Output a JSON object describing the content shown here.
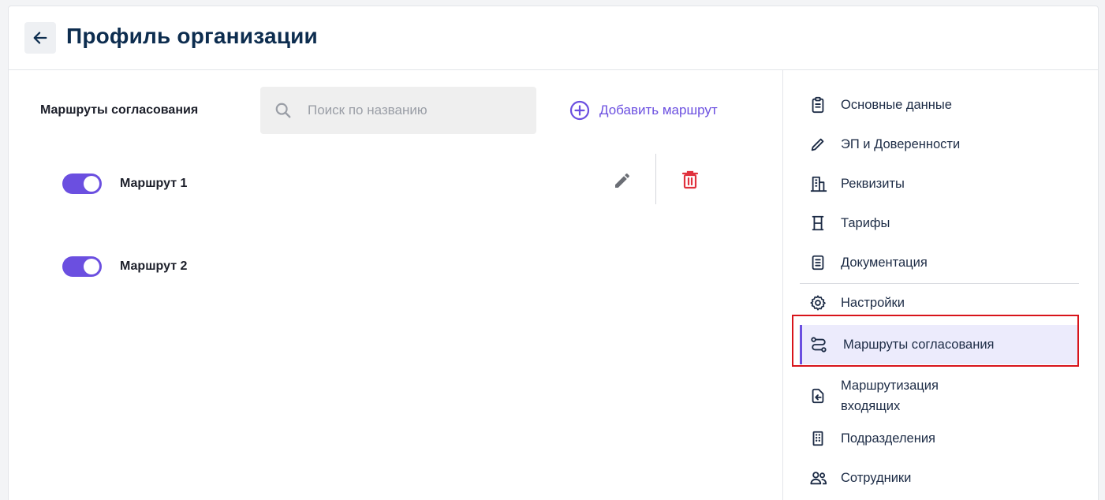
{
  "header": {
    "title": "Профиль организации",
    "back_icon": "arrow-left-icon"
  },
  "main": {
    "section_title": "Маршруты согласования",
    "search": {
      "placeholder": "Поиск по названию",
      "value": ""
    },
    "add_route_label": "Добавить маршрут",
    "routes": [
      {
        "name": "Маршрут 1",
        "enabled": true
      },
      {
        "name": "Маршрут 2",
        "enabled": true
      }
    ]
  },
  "sidebar": {
    "items": [
      {
        "label": "Основные данные",
        "icon": "clipboard-icon"
      },
      {
        "label": "ЭП и Доверенности",
        "icon": "pencil-icon"
      },
      {
        "label": "Реквизиты",
        "icon": "building-icon"
      },
      {
        "label": "Тарифы",
        "icon": "tariff-icon"
      },
      {
        "label": "Документация",
        "icon": "document-icon"
      },
      {
        "label": "Настройки",
        "icon": "gear-icon"
      },
      {
        "label": "Маршруты согласования",
        "icon": "route-icon",
        "active": true
      },
      {
        "label": "Маршрутизация входящих",
        "icon": "incoming-icon"
      },
      {
        "label": "Подразделения",
        "icon": "departments-icon"
      },
      {
        "label": "Сотрудники",
        "icon": "users-icon"
      }
    ]
  },
  "colors": {
    "accent": "#6b4fe0",
    "title": "#0d2d4f",
    "delete": "#e0313d",
    "highlight": "#d8141a"
  }
}
